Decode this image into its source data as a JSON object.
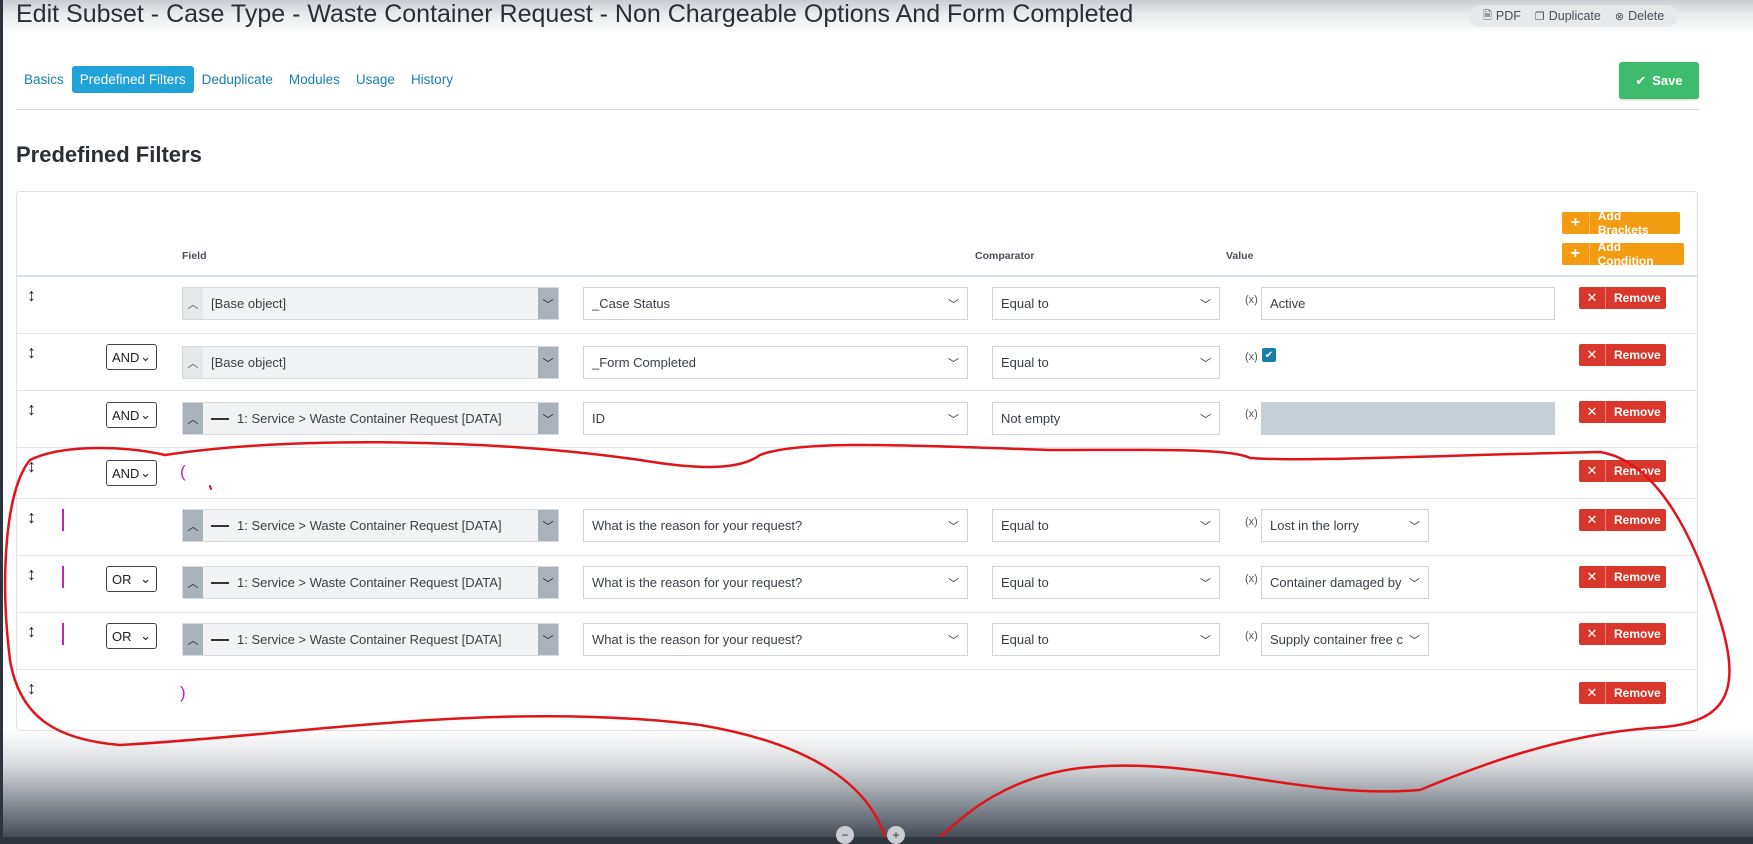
{
  "header": {
    "title": "Edit Subset - Case Type - Waste Container Request - Non Chargeable Options And Form Completed",
    "actions": [
      {
        "label": "PDF",
        "icon": "pdf-icon"
      },
      {
        "label": "Duplicate",
        "icon": "copy-icon"
      },
      {
        "label": "Delete",
        "icon": "delete-icon"
      }
    ]
  },
  "tabs": [
    "Basics",
    "Predefined Filters",
    "Deduplicate",
    "Modules",
    "Usage",
    "History"
  ],
  "active_tab": "Predefined Filters",
  "save_label": "Save",
  "section_title": "Predefined Filters",
  "buttons": {
    "add_brackets": "Add Brackets",
    "add_condition": "Add Condition",
    "remove": "Remove"
  },
  "columns": {
    "field": "Field",
    "comparator": "Comparator",
    "value": "Value"
  },
  "rows": [
    {
      "logic": "",
      "object": "[Base object]",
      "field": "_Case Status",
      "comparator": "Equal to",
      "value": "Active"
    },
    {
      "logic": "AND",
      "object": "[Base object]",
      "field": "_Form Completed",
      "comparator": "Equal to",
      "value": "checked"
    },
    {
      "logic": "AND",
      "object": "1: Service > Waste Container Request [DATA]",
      "field": "ID",
      "comparator": "Not empty",
      "value": ""
    },
    {
      "logic": "AND",
      "bracket": "("
    },
    {
      "logic": "",
      "object": "1: Service > Waste Container Request [DATA]",
      "field": "What is the reason for your request?",
      "comparator": "Equal to",
      "value": "Lost in the lorry"
    },
    {
      "logic": "OR",
      "object": "1: Service > Waste Container Request [DATA]",
      "field": "What is the reason for your request?",
      "comparator": "Equal to",
      "value": "Container damaged by"
    },
    {
      "logic": "OR",
      "object": "1: Service > Waste Container Request [DATA]",
      "field": "What is the reason for your request?",
      "comparator": "Equal to",
      "value": "Supply container free c"
    },
    {
      "logic": "",
      "bracket": ")"
    }
  ],
  "colors": {
    "accent": "#1fa3d8",
    "save": "#3dbd6b",
    "add": "#f39c12",
    "remove": "#d9372b",
    "bracket": "#c81fbf",
    "annotation": "#e0141b"
  }
}
